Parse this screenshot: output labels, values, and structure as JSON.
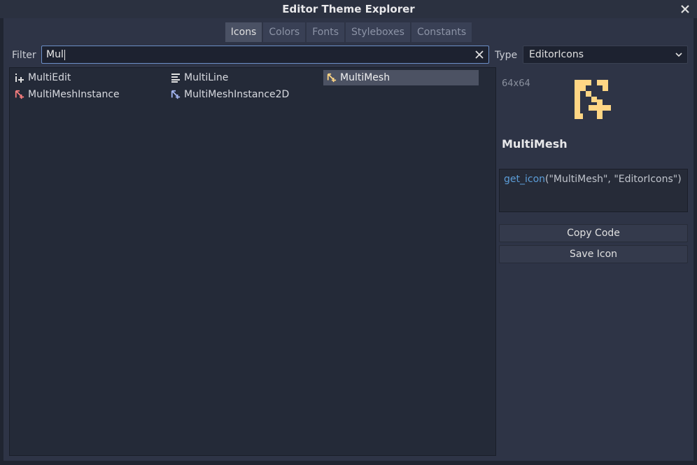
{
  "window": {
    "title": "Editor Theme Explorer"
  },
  "tabs": [
    {
      "label": "Icons",
      "active": true
    },
    {
      "label": "Colors",
      "active": false
    },
    {
      "label": "Fonts",
      "active": false
    },
    {
      "label": "Styleboxes",
      "active": false
    },
    {
      "label": "Constants",
      "active": false
    }
  ],
  "filter": {
    "label": "Filter",
    "value": "Mul"
  },
  "type": {
    "label": "Type",
    "value": "EditorIcons"
  },
  "icons": [
    {
      "name": "MultiEdit",
      "icon": "multi-edit-icon",
      "selected": false
    },
    {
      "name": "MultiLine",
      "icon": "multi-line-icon",
      "selected": false
    },
    {
      "name": "MultiMesh",
      "icon": "multi-mesh-icon",
      "selected": true
    },
    {
      "name": "MultiMeshInstance",
      "icon": "multi-mesh-instance-icon",
      "selected": false
    },
    {
      "name": "MultiMeshInstance2D",
      "icon": "multi-mesh-instance-2d-icon",
      "selected": false
    }
  ],
  "preview": {
    "size": "64x64",
    "name": "MultiMesh",
    "code_fn": "get_icon",
    "code_args": "(\"MultiMesh\", \"EditorIcons\")",
    "copy_label": "Copy Code",
    "save_label": "Save Icon"
  },
  "colors": {
    "accent": "#6c8fc7",
    "mesh_yellow": "#ffd684",
    "instance_red": "#fc7f7f",
    "instance2d_blue": "#a5b7f3"
  }
}
